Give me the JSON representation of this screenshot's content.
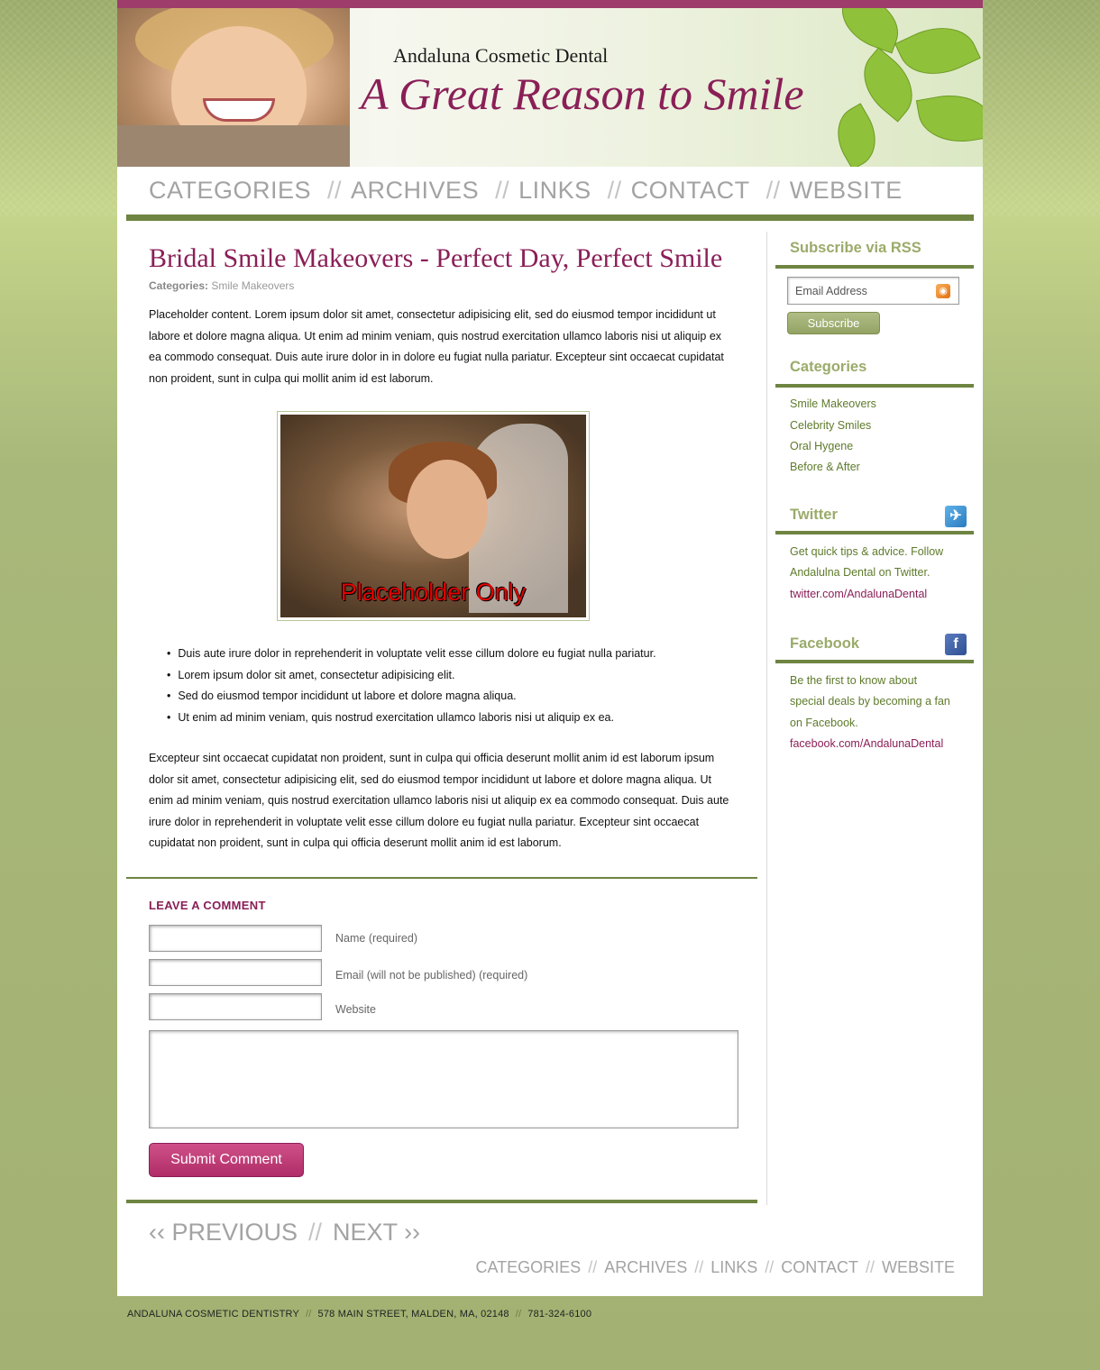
{
  "header": {
    "brand_small": "Andaluna Cosmetic Dental",
    "brand_tagline": "A Great Reason to Smile"
  },
  "nav": {
    "items": [
      "CATEGORIES",
      "ARCHIVES",
      "LINKS",
      "CONTACT",
      "WEBSITE"
    ],
    "separator": "//"
  },
  "post": {
    "title": "Bridal Smile Makeovers - Perfect Day, Perfect Smile",
    "categories_label": "Categories:",
    "category": "Smile Makeovers",
    "paragraph1": "Placeholder content. Lorem ipsum dolor sit amet, consectetur adipisicing elit, sed do eiusmod tempor incididunt ut labore et dolore magna aliqua. Ut enim ad minim veniam, quis nostrud exercitation ullamco laboris nisi ut aliquip ex ea commodo consequat. Duis aute irure dolor in in dolore eu fugiat nulla pariatur. Excepteur sint occaecat cupidatat non proident, sunt in culpa qui mollit anim id est laborum.",
    "image_caption": "Placeholder Only",
    "bullets": [
      "Duis aute irure dolor in reprehenderit in voluptate velit esse cillum dolore eu fugiat nulla pariatur.",
      "Lorem ipsum dolor sit amet, consectetur adipisicing elit.",
      "Sed do eiusmod tempor incididunt ut labore et dolore magna aliqua.",
      "Ut enim ad minim veniam, quis nostrud exercitation ullamco laboris nisi ut aliquip ex ea."
    ],
    "paragraph2": "Excepteur sint occaecat cupidatat non proident, sunt in culpa qui officia deserunt mollit anim id est laborum ipsum dolor sit amet, consectetur adipisicing elit, sed do eiusmod tempor incididunt ut labore et dolore magna aliqua. Ut enim ad minim veniam, quis nostrud exercitation ullamco laboris nisi ut aliquip ex ea commodo consequat. Duis aute irure dolor in reprehenderit in voluptate velit esse cillum dolore eu fugiat nulla pariatur. Excepteur sint occaecat cupidatat non proident, sunt in culpa qui officia deserunt mollit anim id est laborum."
  },
  "comment": {
    "title": "LEAVE A COMMENT",
    "name_label": "Name (required)",
    "email_label": "Email (will not be published) (required)",
    "website_label": "Website",
    "submit_label": "Submit Comment"
  },
  "pagination": {
    "previous": "‹‹ PREVIOUS",
    "next": "NEXT ››",
    "separator": "//"
  },
  "sidebar": {
    "rss": {
      "title": "Subscribe via RSS",
      "email_placeholder": "Email Address",
      "subscribe_label": "Subscribe"
    },
    "categories": {
      "title": "Categories",
      "items": [
        "Smile Makeovers",
        "Celebrity Smiles",
        "Oral Hygene",
        "Before & After"
      ]
    },
    "twitter": {
      "title": "Twitter",
      "text": "Get quick tips & advice. Follow Andalulna Dental on Twitter.",
      "url": "twitter.com/AndalunaDental"
    },
    "facebook": {
      "title": "Facebook",
      "text": "Be the first to know about special deals by becoming a fan on Facebook.",
      "url": "facebook.com/AndalunaDental"
    }
  },
  "footer": {
    "company": "ANDALUNA COSMETIC DENTISTRY",
    "address": "578 MAIN STREET, MALDEN, MA, 02148",
    "phone": "781-324-6100",
    "separator": "//"
  },
  "colors": {
    "accent_plum": "#8a1f57",
    "olive_rule": "#6e8441",
    "sidebar_heading": "#9aab6a",
    "sidebar_text": "#5e7a2b"
  }
}
